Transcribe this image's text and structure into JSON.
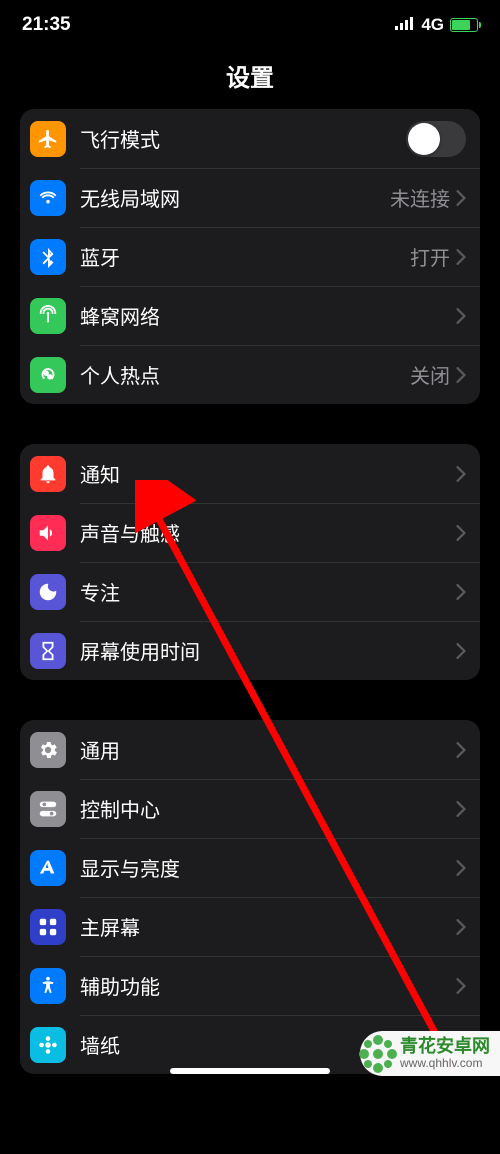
{
  "status": {
    "time": "21:35",
    "network": "4G"
  },
  "header": {
    "title": "设置"
  },
  "groups": {
    "g0": [
      {
        "id": "airplane",
        "label": "飞行模式",
        "value": "",
        "toggle": true,
        "color": "#ff9500"
      },
      {
        "id": "wifi",
        "label": "无线局域网",
        "value": "未连接",
        "color": "#007aff"
      },
      {
        "id": "bluetooth",
        "label": "蓝牙",
        "value": "打开",
        "color": "#007aff"
      },
      {
        "id": "cellular",
        "label": "蜂窝网络",
        "value": "",
        "color": "#34c759"
      },
      {
        "id": "hotspot",
        "label": "个人热点",
        "value": "关闭",
        "color": "#34c759"
      }
    ],
    "g1": [
      {
        "id": "notifications",
        "label": "通知",
        "value": "",
        "color": "#ff3b30"
      },
      {
        "id": "sound",
        "label": "声音与触感",
        "value": "",
        "color": "#ff2d55"
      },
      {
        "id": "focus",
        "label": "专注",
        "value": "",
        "color": "#5856d6"
      },
      {
        "id": "screentime",
        "label": "屏幕使用时间",
        "value": "",
        "color": "#5856d6"
      }
    ],
    "g2": [
      {
        "id": "general",
        "label": "通用",
        "value": "",
        "color": "#8e8e93"
      },
      {
        "id": "control",
        "label": "控制中心",
        "value": "",
        "color": "#8e8e93"
      },
      {
        "id": "display",
        "label": "显示与亮度",
        "value": "",
        "color": "#007aff"
      },
      {
        "id": "home",
        "label": "主屏幕",
        "value": "",
        "color": "#2f3fc7"
      },
      {
        "id": "accessibility",
        "label": "辅助功能",
        "value": "",
        "color": "#007aff"
      },
      {
        "id": "wallpaper",
        "label": "墙纸",
        "value": "",
        "color": "#0abde3"
      }
    ]
  },
  "watermark": {
    "title": "青花安卓网",
    "url": "www.qhhlv.com"
  }
}
